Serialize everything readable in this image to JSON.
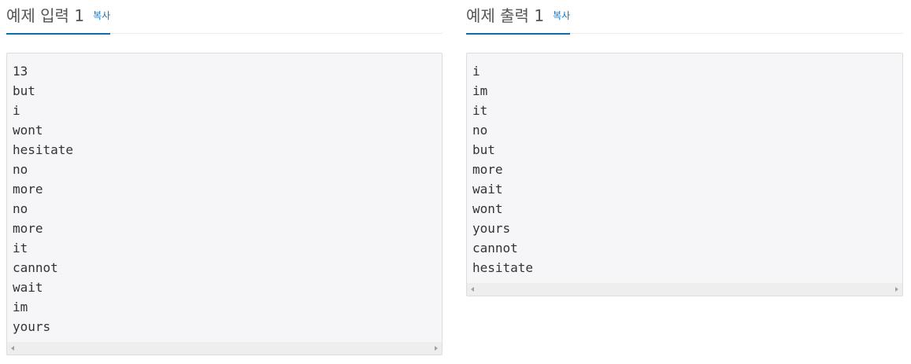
{
  "input_section": {
    "title": "예제 입력 1",
    "copy_label": "복사",
    "lines": [
      "13",
      "but",
      "i",
      "wont",
      "hesitate",
      "no",
      "more",
      "no",
      "more",
      "it",
      "cannot",
      "wait",
      "im",
      "yours"
    ]
  },
  "output_section": {
    "title": "예제 출력 1",
    "copy_label": "복사",
    "lines": [
      "i",
      "im",
      "it",
      "no",
      "but",
      "more",
      "wait",
      "wont",
      "yours",
      "cannot",
      "hesitate"
    ]
  },
  "colors": {
    "accent": "#0f6ea8",
    "link": "#1a73b8",
    "box_background": "#f6f6f8",
    "text": "#333333"
  }
}
